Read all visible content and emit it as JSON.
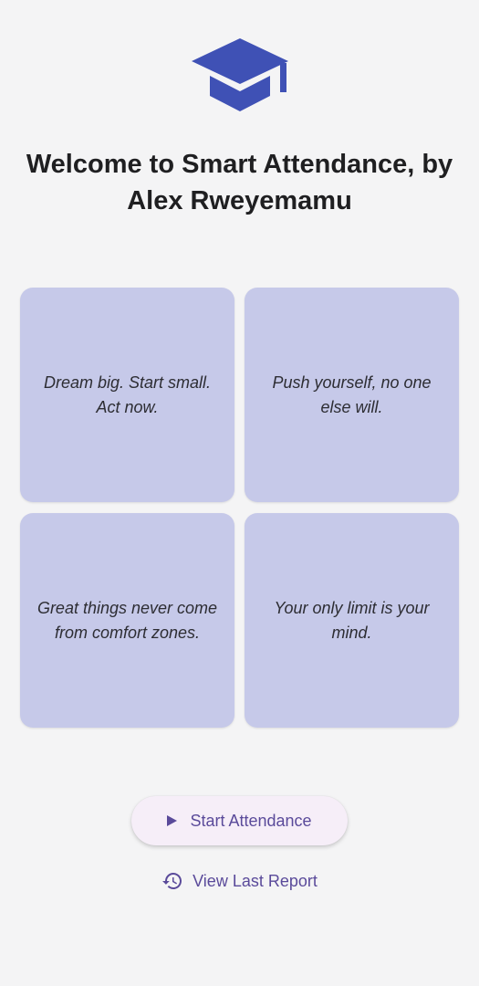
{
  "header": {
    "logo_icon": "graduation-cap-icon",
    "title": "Welcome to Smart Attendance, by Alex Rweyemamu"
  },
  "quotes": [
    {
      "text": "Dream big. Start small. Act now."
    },
    {
      "text": "Push yourself, no one else will."
    },
    {
      "text": "Great things never come from comfort zones."
    },
    {
      "text": "Your only limit is your mind."
    }
  ],
  "actions": {
    "start_label": "Start Attendance",
    "start_icon": "play-icon",
    "report_label": "View Last Report",
    "report_icon": "history-icon"
  },
  "colors": {
    "background": "#f4f4f5",
    "card": "#c6c9e9",
    "logo": "#3f51b5",
    "accent": "#5a4a9a",
    "button_bg": "#f6eef8"
  }
}
